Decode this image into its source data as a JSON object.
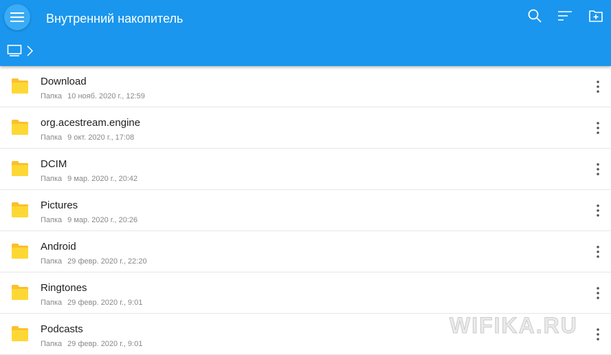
{
  "header": {
    "title": "Внутренний накопитель",
    "menu_icon": "hamburger-icon",
    "actions": [
      {
        "name": "search-icon"
      },
      {
        "name": "sort-icon"
      },
      {
        "name": "new-folder-icon"
      }
    ]
  },
  "breadcrumb": {
    "root_icon": "device-icon",
    "separator_icon": "chevron-right-icon"
  },
  "colors": {
    "appbar": "#1a96ee",
    "folder": "#fbc02d",
    "title_text": "#ffffff"
  },
  "files": [
    {
      "name": "Download",
      "type": "Папка",
      "date": "10 нояб. 2020 г., 12:59"
    },
    {
      "name": "org.acestream.engine",
      "type": "Папка",
      "date": "9 окт. 2020 г., 17:08"
    },
    {
      "name": "DCIM",
      "type": "Папка",
      "date": "9 мар. 2020 г., 20:42"
    },
    {
      "name": "Pictures",
      "type": "Папка",
      "date": "9 мар. 2020 г., 20:26"
    },
    {
      "name": "Android",
      "type": "Папка",
      "date": "29 февр. 2020 г., 22:20"
    },
    {
      "name": "Ringtones",
      "type": "Папка",
      "date": "29 февр. 2020 г., 9:01"
    },
    {
      "name": "Podcasts",
      "type": "Папка",
      "date": "29 февр. 2020 г., 9:01"
    }
  ],
  "watermark": {
    "text": "WIFIKA.RU"
  }
}
